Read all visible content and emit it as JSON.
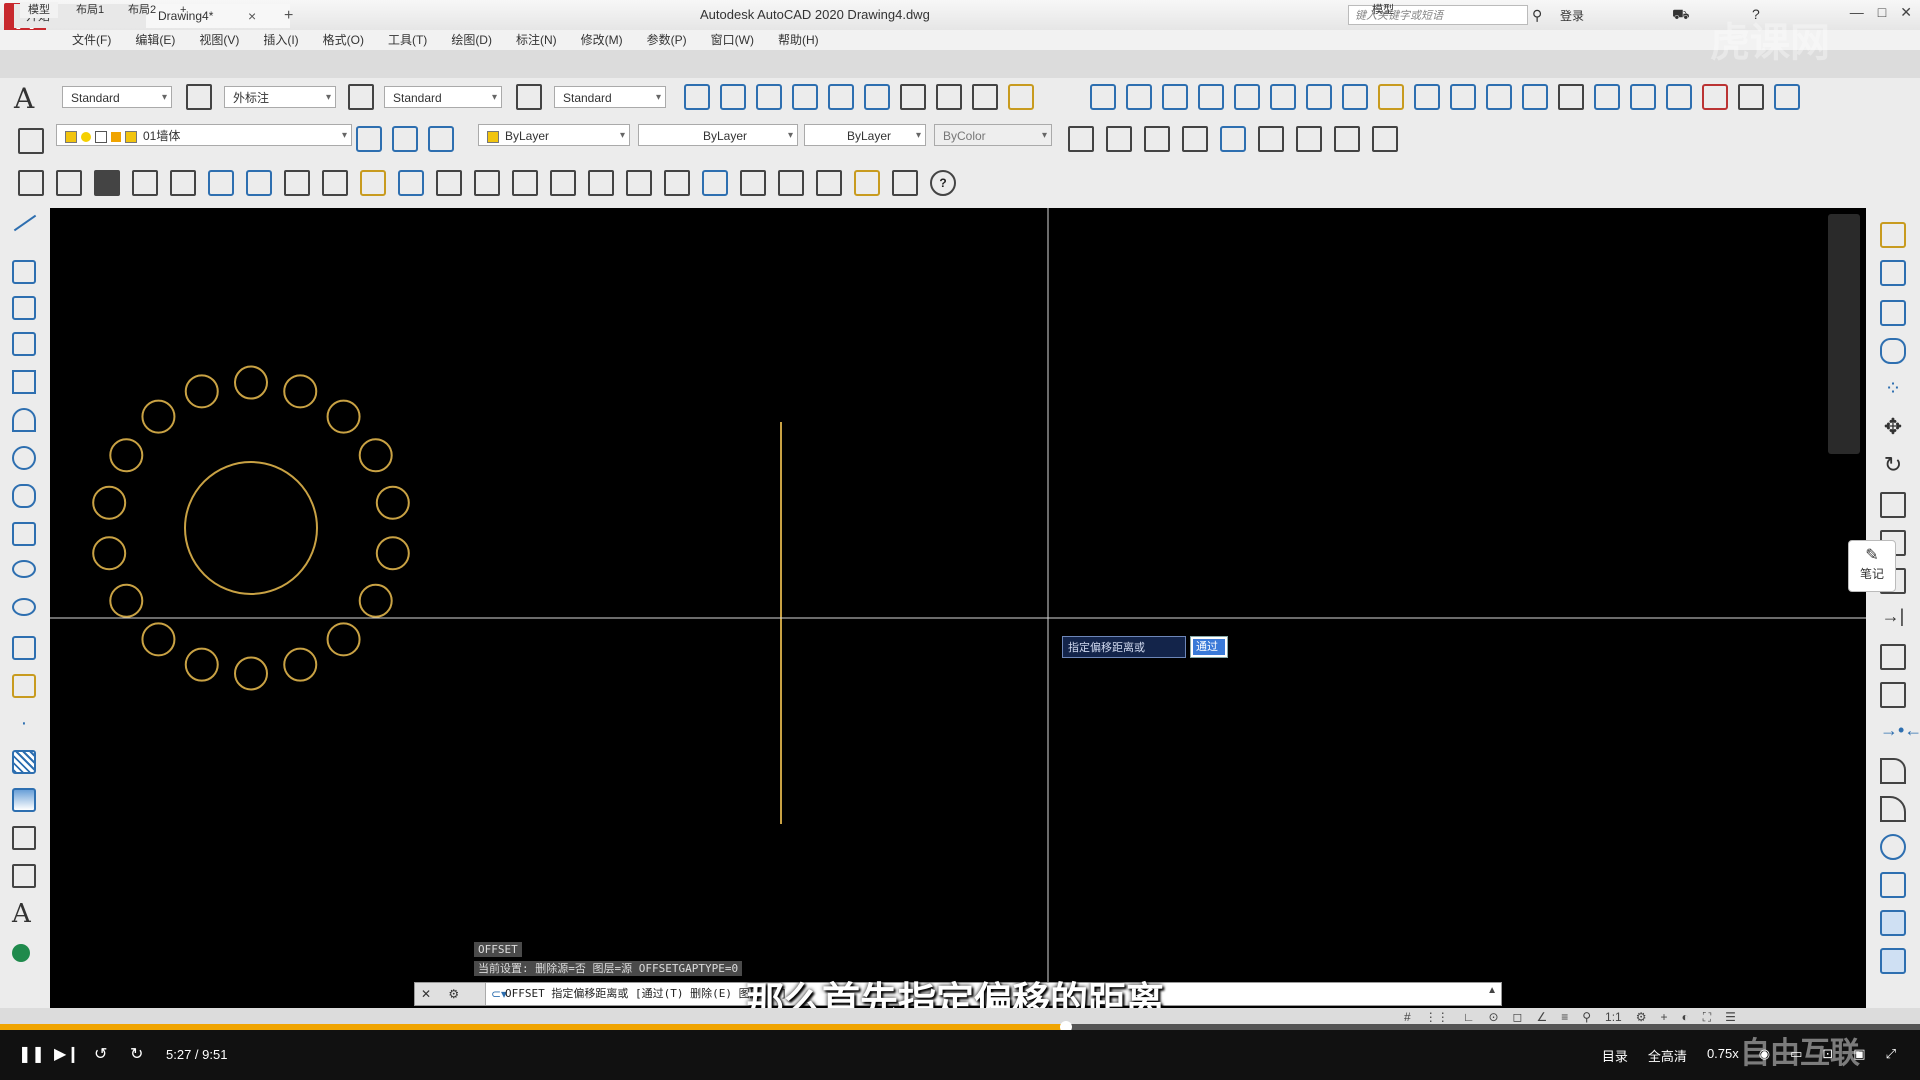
{
  "app": {
    "logo": "A",
    "title": "Autodesk AutoCAD 2020    Drawing4.dwg",
    "search_placeholder": "键入关键字或短语",
    "login": "登录"
  },
  "menu": [
    "文件(F)",
    "编辑(E)",
    "视图(V)",
    "插入(I)",
    "格式(O)",
    "工具(T)",
    "绘图(D)",
    "标注(N)",
    "修改(M)",
    "参数(P)",
    "窗口(W)",
    "帮助(H)"
  ],
  "tabs": {
    "start": "开始",
    "drawing": "Drawing4*",
    "close": "×",
    "add": "+"
  },
  "styles_toolbar": {
    "text_style": "Standard",
    "dim_style": "外标注",
    "table_style": "Standard",
    "mleader_style": "Standard"
  },
  "layers_toolbar": {
    "layer": "01墙体",
    "color": "ByLayer",
    "linetype": "ByLayer",
    "lineweight": "ByLayer",
    "plotstyle": "ByColor"
  },
  "canvas": {
    "background": "#000000",
    "geometry_color": "#c9a244",
    "crosshair_color": "#d8d8d8"
  },
  "note_button": "笔记",
  "dynamic_input": {
    "prompt": "指定偏移距离或",
    "value": "通过"
  },
  "command": {
    "history1": "OFFSET",
    "history2": "当前设置: 删除源=否  图层=源  OFFSETGAPTYPE=0",
    "current": "OFFSET 指定偏移距离或 [通过(T) 删除(E) 图层(L)]"
  },
  "layout_tabs": [
    "模型",
    "布局1",
    "布局2",
    "+"
  ],
  "status_model": "模型",
  "subtitle": "那么首先指定偏移的距离",
  "player": {
    "time": "5:27 / 9:51",
    "progress": 0.555,
    "catalog": "目录",
    "quality": "全高清",
    "speed": "0.75x"
  },
  "watermark_top": "虎课网",
  "watermark_bottom": "自由互联"
}
